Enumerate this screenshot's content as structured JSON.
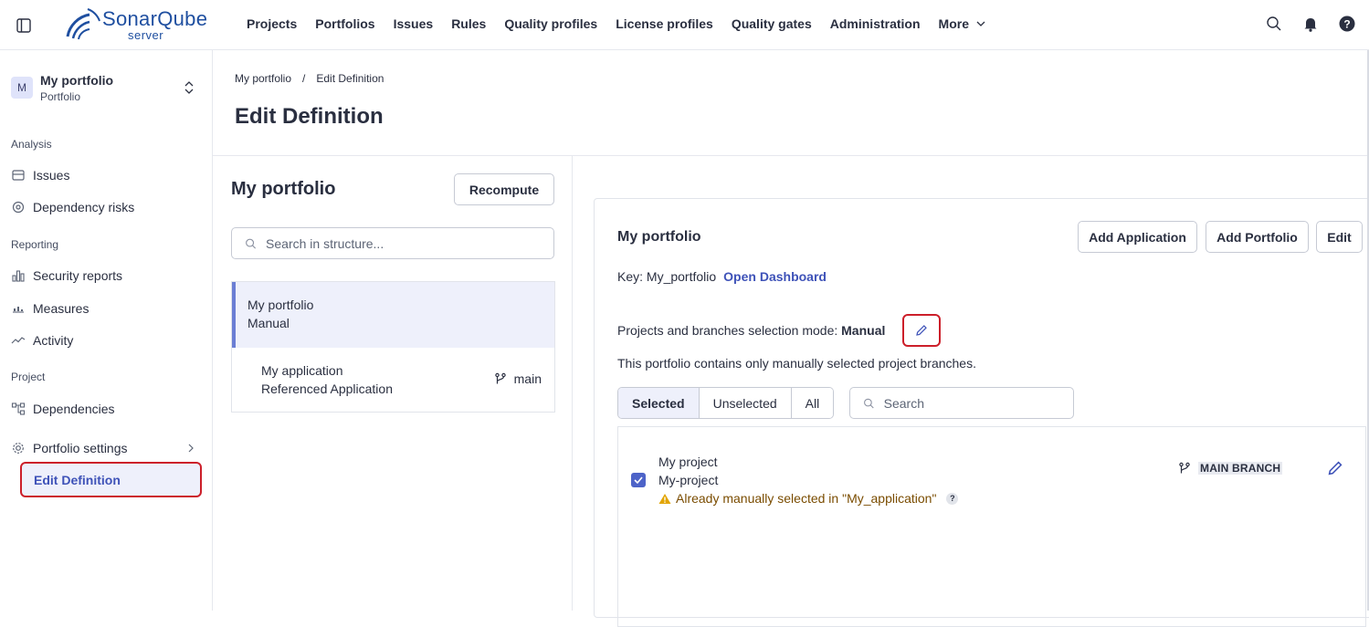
{
  "topnav": {
    "logo_word": "SonarQube",
    "logo_sub": "server",
    "links": [
      "Projects",
      "Portfolios",
      "Issues",
      "Rules",
      "Quality profiles",
      "License profiles",
      "Quality gates",
      "Administration"
    ],
    "more_label": "More",
    "icons": [
      "search-icon",
      "bell-icon",
      "help-icon"
    ]
  },
  "sidebar": {
    "avatar_letter": "M",
    "project_name": "My portfolio",
    "project_type": "Portfolio",
    "sections": {
      "analysis": "Analysis",
      "reporting": "Reporting",
      "project": "Project"
    },
    "items": {
      "issues": "Issues",
      "dependency_risks": "Dependency risks",
      "security_reports": "Security reports",
      "measures": "Measures",
      "activity": "Activity",
      "dependencies": "Dependencies",
      "portfolio_settings": "Portfolio settings",
      "edit_definition": "Edit Definition"
    }
  },
  "header": {
    "breadcrumb_root": "My portfolio",
    "breadcrumb_sep": "/",
    "breadcrumb_current": "Edit Definition",
    "title": "Edit Definition"
  },
  "tree": {
    "title": "My portfolio",
    "recompute_label": "Recompute",
    "search_placeholder": "Search in structure...",
    "nodes": [
      {
        "name": "My portfolio",
        "sub": "Manual"
      },
      {
        "name": "My application",
        "sub": "Referenced Application",
        "branch": "main"
      }
    ]
  },
  "detail": {
    "title": "My portfolio",
    "add_application": "Add Application",
    "add_portfolio": "Add Portfolio",
    "edit": "Edit",
    "key_label": "Key: My_portfolio",
    "open_dashboard": "Open Dashboard",
    "mode_label": "Projects and branches selection mode:",
    "mode_value": "Manual",
    "mode_desc": "This portfolio contains only manually selected project branches.",
    "filters": [
      "Selected",
      "Unselected",
      "All"
    ],
    "active_filter": "Selected",
    "search_placeholder": "Search",
    "project": {
      "name": "My project",
      "key": "My-project",
      "warning": "Already manually selected in \"My_application\"",
      "branch_label": "MAIN BRANCH",
      "checked": true
    }
  },
  "colors": {
    "accent": "#3e52b8",
    "highlight_border": "#cc1f2a",
    "selected_bg": "#eef0fb"
  }
}
